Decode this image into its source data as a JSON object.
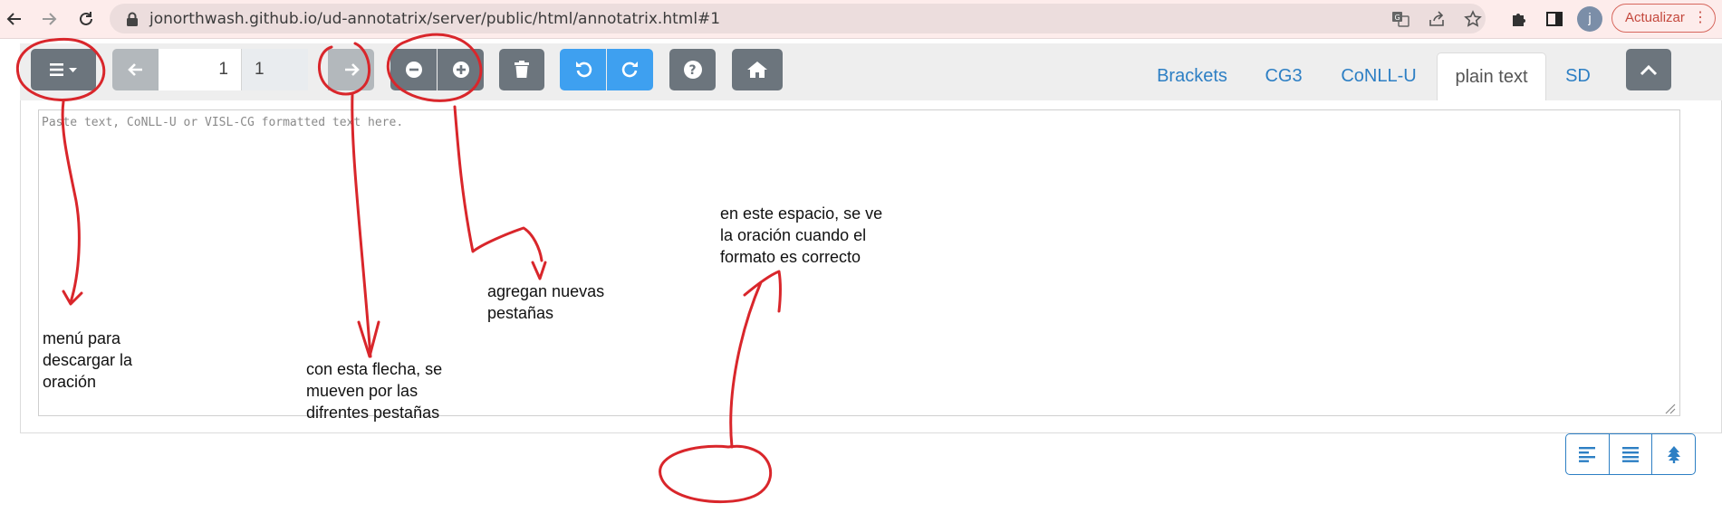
{
  "browser": {
    "url": "jonorthwash.github.io/ud-annotatrix/server/public/html/annotatrix.html#1",
    "profile_initial": "j",
    "update_label": "Actualizar",
    "icons": [
      "back-arrow-icon",
      "forward-arrow-icon",
      "reload-icon",
      "lock-icon",
      "translate-icon",
      "share-icon",
      "star-icon",
      "extensions-icon",
      "sidebar-icon",
      "kebab-menu-icon"
    ]
  },
  "toolbar": {
    "current_sentence": "1",
    "total_sentences": "1",
    "icons": [
      "hamburger-menu-icon",
      "left-arrow-icon",
      "right-arrow-icon",
      "minus-circle-icon",
      "plus-circle-icon",
      "trash-icon",
      "undo-icon",
      "redo-icon",
      "help-icon",
      "home-icon",
      "chevron-up-icon"
    ]
  },
  "tabs": [
    {
      "label": "Brackets",
      "active": false
    },
    {
      "label": "CG3",
      "active": false
    },
    {
      "label": "CoNLL-U",
      "active": false
    },
    {
      "label": "plain text",
      "active": true
    },
    {
      "label": "SD",
      "active": false
    }
  ],
  "editor": {
    "placeholder": "Paste text, CoNLL-U or VISL-CG formatted text here.",
    "value": ""
  },
  "view_buttons": [
    "align-left-icon",
    "align-justify-icon",
    "tree-icon"
  ],
  "annotations": {
    "menu": "menú para\ndescargar la\noración",
    "arrow": "con esta flecha, se\nmueven por las\ndifrentes pestañas",
    "tabs": "agregan nuevas\npestañas",
    "space": "en este espacio, se ve\nla oración cuando el\nformato es correcto"
  },
  "colors": {
    "chrome": "#fdeceb",
    "button_gray": "#6c757d",
    "button_blue": "#3ea0f0",
    "link_blue": "#2d7fc4",
    "annotation_red": "#d9262b"
  }
}
